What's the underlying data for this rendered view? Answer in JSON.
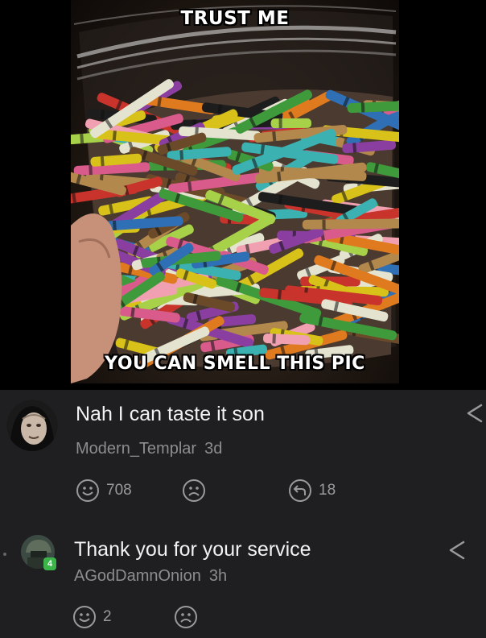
{
  "meme": {
    "top_caption": "TRUST ME",
    "bottom_caption": "YOU CAN SMELL THIS PIC"
  },
  "comments": [
    {
      "text": "Nah I can taste it son",
      "author": "Modern_Templar",
      "age": "3d",
      "likes": "708",
      "replies": "18",
      "like_icon": "smile-icon",
      "dislike_icon": "frown-icon",
      "reply_icon": "reply-icon",
      "share_icon": "share-icon"
    },
    {
      "text": "Thank you for your service",
      "author": "AGodDamnOnion",
      "age": "3h",
      "likes": "2",
      "level": "4",
      "like_icon": "smile-icon",
      "dislike_icon": "frown-icon",
      "share_icon": "share-icon"
    }
  ],
  "colors": {
    "background": "#000000",
    "panel": "#1f1f21",
    "text": "#f2f2f2",
    "muted": "#8d8d8f",
    "level_badge": "#3bb44a"
  }
}
